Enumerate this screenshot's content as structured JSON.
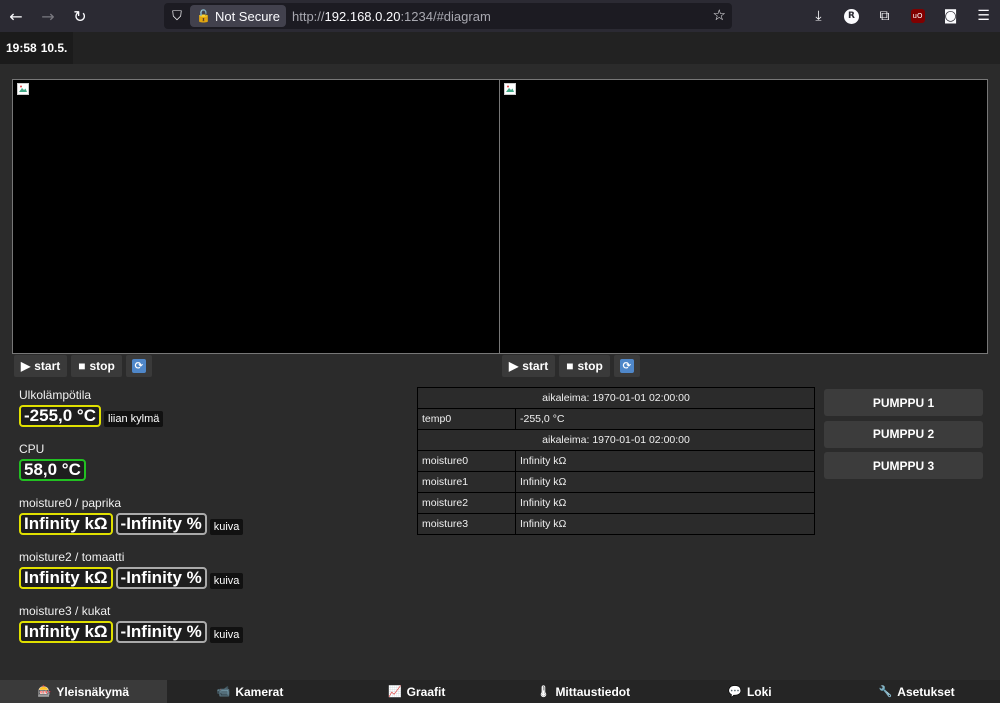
{
  "browser": {
    "security_label": "Not Secure",
    "url_scheme": "http://",
    "url_host": "192.168.0.20",
    "url_rest": ":1234/#diagram",
    "profile_initial": "R",
    "ublock_label": "uO"
  },
  "header": {
    "time": "19:58",
    "date": "10.5."
  },
  "cameras": [
    {
      "start_label": "start",
      "stop_label": "stop"
    },
    {
      "start_label": "start",
      "stop_label": "stop"
    }
  ],
  "sensors": [
    {
      "label": "Ulkolämpötila",
      "value": "-255,0 °C",
      "color": "yellow",
      "tag": "liian kylmä"
    },
    {
      "label": "CPU",
      "value": "58,0 °C",
      "color": "green"
    },
    {
      "label": "moisture0 / paprika",
      "value": "Infinity kΩ",
      "percent": "-Infinity %",
      "tag": "kuiva"
    },
    {
      "label": "moisture2 / tomaatti",
      "value": "Infinity kΩ",
      "percent": "-Infinity %",
      "tag": "kuiva"
    },
    {
      "label": "moisture3 / kukat",
      "value": "Infinity kΩ",
      "percent": "-Infinity %",
      "tag": "kuiva"
    }
  ],
  "table": {
    "group1_header": "aikaleima: 1970-01-01 02:00:00",
    "group1_rows": [
      {
        "key": "temp0",
        "value": "-255,0 °C"
      }
    ],
    "group2_header": "aikaleima: 1970-01-01 02:00:00",
    "group2_rows": [
      {
        "key": "moisture0",
        "value": "Infinity kΩ"
      },
      {
        "key": "moisture1",
        "value": "Infinity kΩ"
      },
      {
        "key": "moisture2",
        "value": "Infinity kΩ"
      },
      {
        "key": "moisture3",
        "value": "Infinity kΩ"
      }
    ]
  },
  "pumps": [
    "PUMPPU 1",
    "PUMPPU 2",
    "PUMPPU 3"
  ],
  "bottom_nav": [
    {
      "label": "Yleisnäkymä",
      "icon": "dashboard-icon",
      "active": true
    },
    {
      "label": "Kamerat",
      "icon": "camera-icon"
    },
    {
      "label": "Graafit",
      "icon": "chart-icon"
    },
    {
      "label": "Mittaustiedot",
      "icon": "thermometer-icon"
    },
    {
      "label": "Loki",
      "icon": "speech-bubble-icon"
    },
    {
      "label": "Asetukset",
      "icon": "wrench-icon"
    }
  ],
  "colors": {
    "yellow": "#e0e000",
    "green": "#22c022",
    "gray": "#aaaaaa"
  }
}
